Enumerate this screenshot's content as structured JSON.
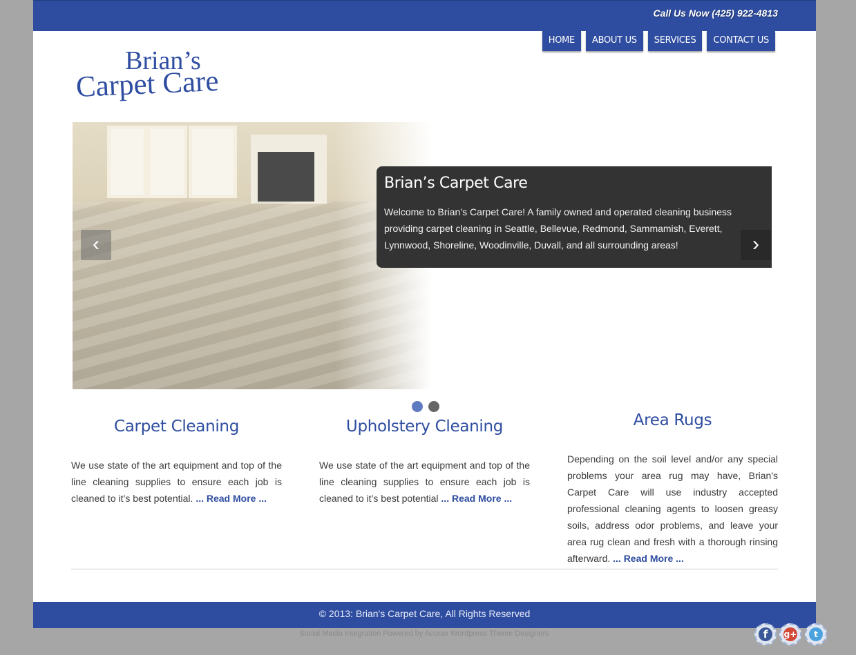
{
  "header": {
    "call_text": "Call Us Now (425) 922-4813"
  },
  "nav": {
    "items": [
      {
        "label": "HOME"
      },
      {
        "label": "ABOUT US"
      },
      {
        "label": "SERVICES"
      },
      {
        "label": "CONTACT US"
      }
    ]
  },
  "logo": {
    "line1": "Brian’s",
    "line2": "Carpet Care"
  },
  "slider": {
    "title": "Brian’s Carpet Care",
    "text": "Welcome to Brian’s Carpet Care! A family owned and operated cleaning business providing carpet cleaning in Seattle, Bellevue, Redmond, Sammamish, Everett, Lynnwood, Shoreline, Woodinville, Duvall, and all surrounding areas!",
    "prev_icon": "chevron-left-icon",
    "next_icon": "chevron-right-icon",
    "slide_count": 2,
    "active_slide": 1
  },
  "services": [
    {
      "title": "Carpet Cleaning",
      "text": "We use state of the art equipment and top of the line cleaning supplies to ensure each job is cleaned to it’s best potential. ",
      "link": "... Read More ..."
    },
    {
      "title": "Upholstery Cleaning",
      "text": "We use state of the art equipment and top of the line cleaning supplies to ensure each job is cleaned to it’s best potential ",
      "link": "... Read More ..."
    },
    {
      "title": "Area Rugs",
      "text": "Depending on the soil level and/or any special problems your area rug may have, Brian's Carpet Care will use industry accepted professional cleaning agents to loosen greasy soils, address odor problems, and leave your area rug clean and fresh with a thorough rinsing afterward. ",
      "link": "... Read More ..."
    }
  ],
  "footer": {
    "copyright": "© 2013: Brian's Carpet Care, All Rights Reserved",
    "credit": "Social Media Integration Powered by Acurax Wordpress Theme Designers"
  },
  "social": {
    "icons": [
      "facebook-icon",
      "google-plus-icon",
      "twitter-icon"
    ]
  },
  "colors": {
    "brand_blue": "#2e4da0",
    "page_bg": "#a6a6a6",
    "caption_bg": "#333333"
  }
}
